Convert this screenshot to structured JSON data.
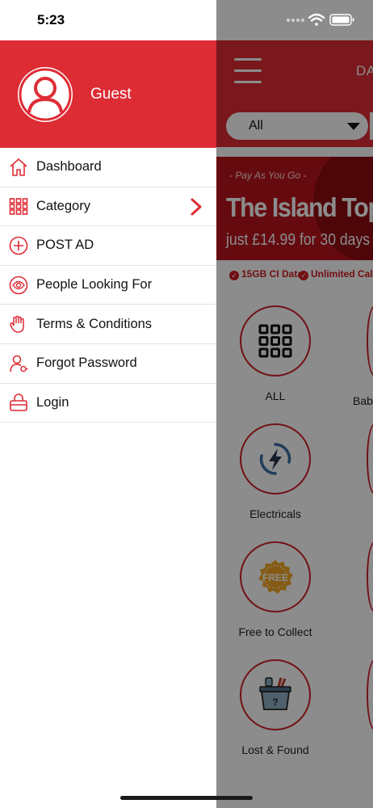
{
  "status_bar": {
    "time": "5:23"
  },
  "drawer": {
    "user_name": "Guest",
    "menu": [
      {
        "label": "Dashboard",
        "icon": "home-icon",
        "has_chevron": false
      },
      {
        "label": "Category",
        "icon": "grid-icon",
        "has_chevron": true
      },
      {
        "label": "POST AD",
        "icon": "plus-circle-icon",
        "has_chevron": false
      },
      {
        "label": "People Looking For",
        "icon": "eye-icon",
        "has_chevron": false
      },
      {
        "label": "Terms & Conditions",
        "icon": "hand-icon",
        "has_chevron": false
      },
      {
        "label": "Forgot Password",
        "icon": "user-key-icon",
        "has_chevron": false
      },
      {
        "label": "Login",
        "icon": "login-icon",
        "has_chevron": false
      }
    ]
  },
  "background": {
    "header_title": "DA",
    "filter_value": "All",
    "banner": {
      "tagline": "- Pay As You Go -",
      "headline": "The Island Top Up",
      "price": "just £14.99 for 30 days",
      "features": [
        "15GB CI Data",
        "Unlimited Calls & Te"
      ]
    },
    "categories": [
      {
        "label": "ALL",
        "icon": "grid-icon"
      },
      {
        "label": "Electricals",
        "icon": "lightning-icon"
      },
      {
        "label": "Free to Collect",
        "icon": "free-badge-icon",
        "badge_text": "FREE"
      },
      {
        "label": "Lost & Found",
        "icon": "lost-found-icon",
        "badge_text": "?"
      }
    ],
    "partial_category_label": "Bab"
  },
  "colors": {
    "primary_red": "#de2c35",
    "free_badge": "#f3a623",
    "electricals_blue": "#3a6ea5"
  }
}
